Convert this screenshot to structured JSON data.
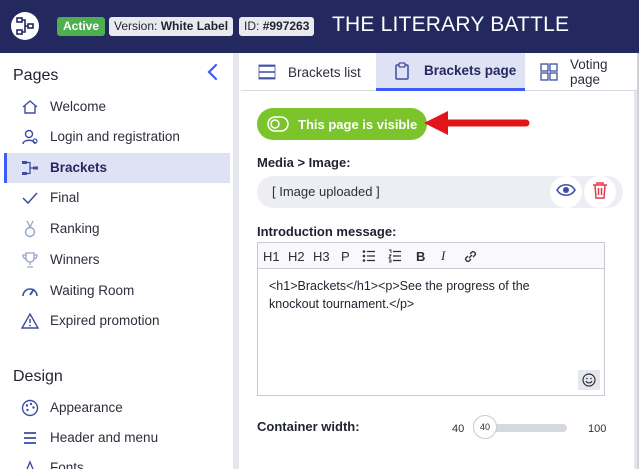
{
  "header": {
    "status_badge": "Active",
    "version_label": "Version:",
    "version_value": "White Label",
    "id_label": "ID:",
    "id_value": "#997263",
    "title": "THE LITERARY BATTLE"
  },
  "sidebar": {
    "section_pages": "Pages",
    "section_design": "Design",
    "pages": [
      {
        "label": "Welcome",
        "icon": "home-icon"
      },
      {
        "label": "Login and registration",
        "icon": "user-login-icon"
      },
      {
        "label": "Brackets",
        "icon": "brackets-icon",
        "active": true
      },
      {
        "label": "Final",
        "icon": "checkmark-icon"
      },
      {
        "label": "Ranking",
        "icon": "medal-icon"
      },
      {
        "label": "Winners",
        "icon": "trophy-icon"
      },
      {
        "label": "Waiting Room",
        "icon": "gauge-icon"
      },
      {
        "label": "Expired promotion",
        "icon": "warning-icon"
      }
    ],
    "design": [
      {
        "label": "Appearance",
        "icon": "palette-icon"
      },
      {
        "label": "Header and menu",
        "icon": "menu-icon"
      },
      {
        "label": "Fonts",
        "icon": "font-icon"
      }
    ]
  },
  "tabs": [
    {
      "label": "Brackets list",
      "icon": "list-icon"
    },
    {
      "label": "Brackets page",
      "icon": "clipboard-icon",
      "active": true
    },
    {
      "label": "Voting page",
      "icon": "grid-icon"
    }
  ],
  "visibility": {
    "label": "This page is visible",
    "on": true
  },
  "media": {
    "label": "Media > Image:",
    "value": "[ Image uploaded ]"
  },
  "intro": {
    "label": "Introduction message:",
    "toolbar": [
      "H1",
      "H2",
      "H3",
      "P"
    ],
    "content": "<h1>Brackets</h1><p>See the progress of the knockout tournament.</p>"
  },
  "container_width": {
    "label": "Container width:",
    "min": "40",
    "max": "100",
    "value": "40"
  },
  "colors": {
    "navy": "#23295e",
    "accent": "#3d5afe",
    "active_green": "#4caf50",
    "visible_green": "#7cc42b",
    "arrow_red": "#e0161b",
    "delete_red": "#e53950"
  }
}
